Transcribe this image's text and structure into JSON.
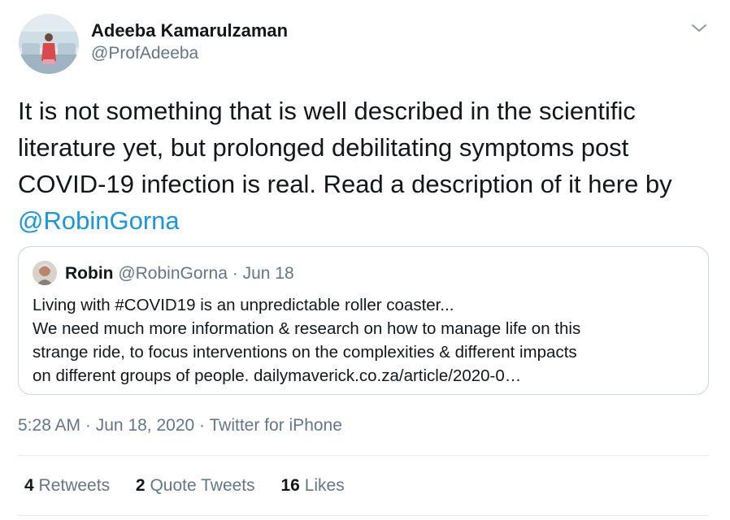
{
  "tweet": {
    "author": {
      "display_name": "Adeeba Kamarulzaman",
      "handle": "@ProfAdeeba"
    },
    "text": "It is not something that is well described in the scientific literature yet, but prolonged debilitating symptoms post COVID-19 infection is real. Read a description of it here by",
    "mention": "@RobinGorna",
    "quoted": {
      "name": "Robin",
      "handle": "@RobinGorna",
      "separator": "·",
      "date": "Jun 18",
      "lines": [
        "Living with #COVID19 is an unpredictable roller coaster...",
        "We need much more information & research on how to manage life on this",
        "strange ride, to focus interventions on the complexities & different impacts",
        "on different groups of people.  dailymaverick.co.za/article/2020-0…"
      ]
    },
    "timestamp": {
      "time": "5:28 AM",
      "date": "Jun 18, 2020",
      "source": "Twitter for iPhone",
      "separator": "·"
    },
    "stats": {
      "retweets_count": "4",
      "retweets_label": "Retweets",
      "quote_count": "2",
      "quote_label": "Quote Tweets",
      "likes_count": "16",
      "likes_label": "Likes"
    }
  },
  "colors": {
    "text": "#14171a",
    "secondary": "#657786",
    "link": "#1b95e0",
    "border": "#ccd6dd",
    "divider": "#e6ecf0"
  },
  "icons": {
    "menu": "chevron-down-icon"
  }
}
